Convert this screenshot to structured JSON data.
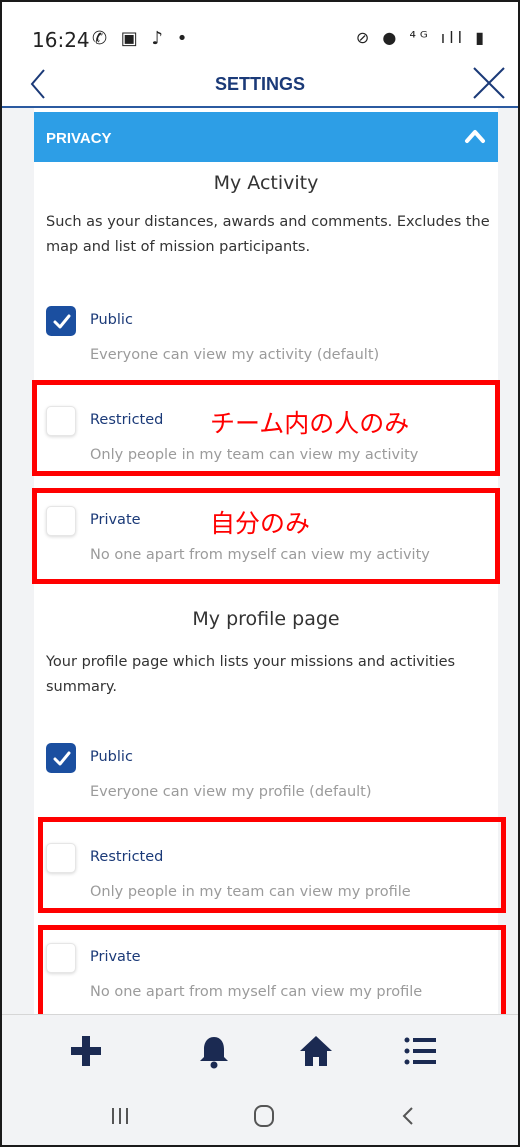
{
  "status_bar": {
    "time": "16:24",
    "left_icons": [
      "whatsapp-icon",
      "gallery-icon",
      "tiktok-icon",
      "dot-icon"
    ],
    "right_icons": [
      "mute-icon",
      "location-icon",
      "4g-icon",
      "signal-icon",
      "battery-icon"
    ],
    "left_icons_text": "✆ ▣ ♪ •",
    "right_icons_text": "⊘ ● ⁴ᴳ ıll ▮"
  },
  "header": {
    "title": "SETTINGS"
  },
  "section": {
    "title": "PRIVACY"
  },
  "activity": {
    "heading": "My Activity",
    "description": "Such as your distances, awards and comments. Excludes the map and list of mission participants.",
    "options": [
      {
        "label": "Public",
        "sub": "Everyone can view my activity (default)",
        "checked": true
      },
      {
        "label": "Restricted",
        "sub": "Only people in my team can view my activity",
        "checked": false
      },
      {
        "label": "Private",
        "sub": "No one apart from myself can view my activity",
        "checked": false
      }
    ]
  },
  "profile": {
    "heading": "My profile page",
    "description": "Your profile page which lists your missions and activities summary.",
    "options": [
      {
        "label": "Public",
        "sub": "Everyone can view my profile (default)",
        "checked": true
      },
      {
        "label": "Restricted",
        "sub": "Only people in my team can view my profile",
        "checked": false
      },
      {
        "label": "Private",
        "sub": "No one apart from myself can view my profile",
        "checked": false
      }
    ]
  },
  "annotations": {
    "restricted_note": "チーム内の人のみ",
    "private_note": "自分のみ",
    "color": "#ff0000"
  },
  "bottom_nav": [
    "plus-icon",
    "bell-icon",
    "home-icon",
    "list-icon"
  ],
  "system_nav": [
    "recents-icon",
    "home-circle-icon",
    "back-chevron-icon"
  ],
  "colors": {
    "accent": "#2d9ee6",
    "primary": "#1b4fa0",
    "title": "#1b3a78",
    "muted": "#9b9b9b"
  }
}
